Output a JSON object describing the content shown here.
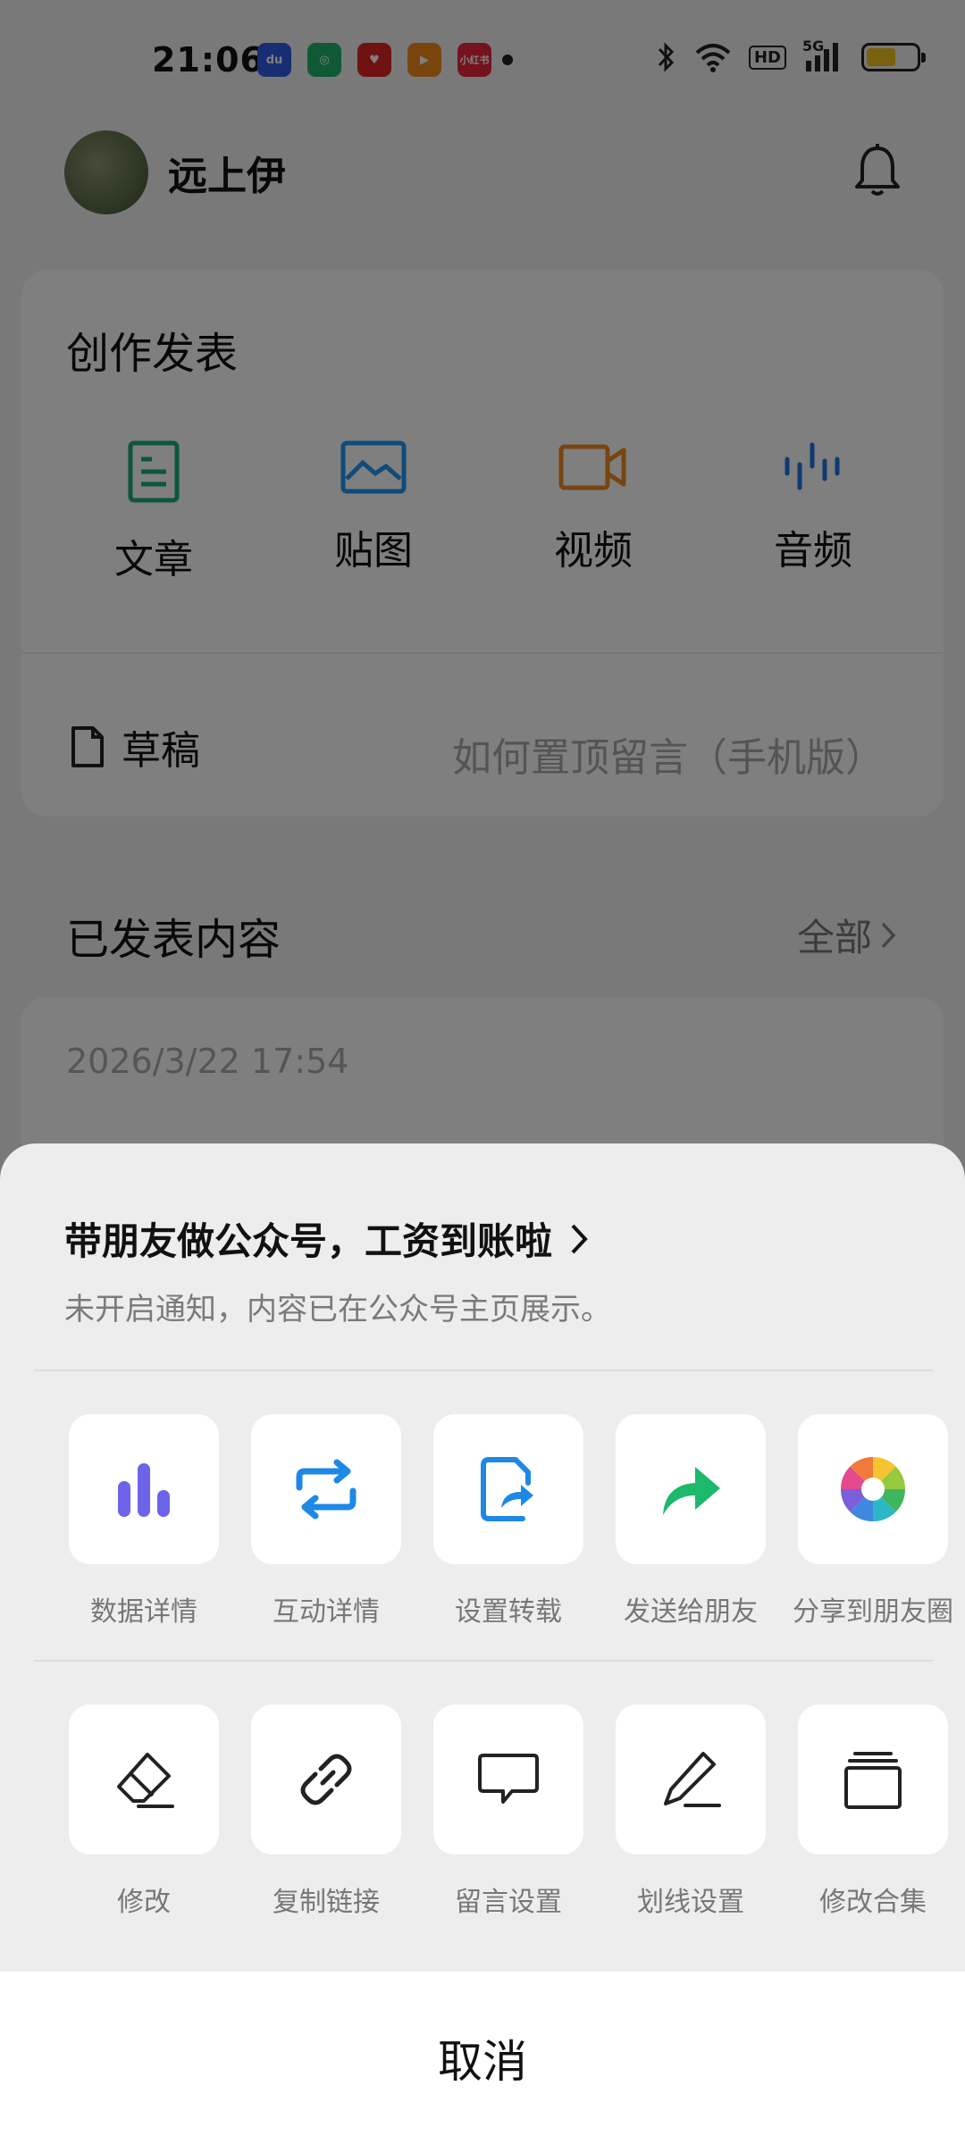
{
  "status_bar": {
    "time": "21:06",
    "apps": [
      {
        "icon": "baidu-app-icon",
        "color": "#2e5ce6",
        "text": "du"
      },
      {
        "icon": "green-app-icon",
        "color": "#1fb56b",
        "text": "◎"
      },
      {
        "icon": "heart-app-icon",
        "color": "#e02424",
        "text": "♥"
      },
      {
        "icon": "video-app-icon",
        "color": "#f28a1a",
        "text": "▶"
      },
      {
        "icon": "xiaohongshu-icon",
        "color": "#e8253c",
        "text": "小红书"
      }
    ],
    "network_badge": "HD",
    "signal_label": "5G",
    "battery_level": 0.6,
    "battery_color": "#f2c21b"
  },
  "profile": {
    "name": "远上伊"
  },
  "create": {
    "title": "创作发表",
    "items": [
      {
        "label": "文章",
        "icon": "article-icon",
        "color": "#1aad7a"
      },
      {
        "label": "贴图",
        "icon": "image-icon",
        "color": "#2196f3"
      },
      {
        "label": "视频",
        "icon": "video-camera-icon",
        "color": "#f08a24"
      },
      {
        "label": "音频",
        "icon": "audio-wave-icon",
        "color": "#1e74e6"
      }
    ],
    "draft_label": "草稿",
    "draft_title": "如何置顶留言（手机版）"
  },
  "published": {
    "header": "已发表内容",
    "all_label": "全部",
    "first_date": "2026/3/22 17:54"
  },
  "sheet": {
    "promo_title": "带朋友做公众号，工资到账啦",
    "notice": "未开启通知，内容已在公众号主页展示。",
    "row1": [
      {
        "label": "数据详情",
        "icon": "bar-chart-icon"
      },
      {
        "label": "互动详情",
        "icon": "repeat-icon"
      },
      {
        "label": "设置转载",
        "icon": "repost-document-icon"
      },
      {
        "label": "发送给朋友",
        "icon": "forward-arrow-icon"
      },
      {
        "label": "分享到朋友圈",
        "icon": "moments-aperture-icon"
      }
    ],
    "row2": [
      {
        "label": "修改",
        "icon": "eraser-icon"
      },
      {
        "label": "复制链接",
        "icon": "link-icon"
      },
      {
        "label": "留言设置",
        "icon": "comment-bubble-icon"
      },
      {
        "label": "划线设置",
        "icon": "pen-underline-icon"
      },
      {
        "label": "修改合集",
        "icon": "collection-stack-icon"
      }
    ],
    "cancel_label": "取消"
  },
  "colors": {
    "bar_chart": "#6d63e8",
    "repeat": "#1e88e5",
    "repost": "#1e88e5",
    "forward": "#1cb86b",
    "overlay": "rgba(0,0,0,0.5)"
  }
}
